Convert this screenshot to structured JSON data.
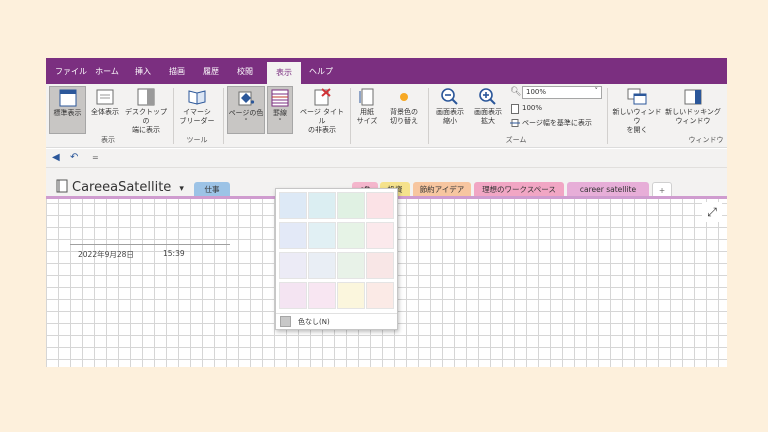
{
  "menu": {
    "tabs": [
      "ファイル",
      "ホーム",
      "挿入",
      "描画",
      "履歴",
      "校閲",
      "表示",
      "ヘルプ"
    ],
    "active": "表示"
  },
  "ribbon": {
    "normal_view": "標準表示",
    "full_page": "全体表示",
    "dock_line1": "デスクトップの",
    "dock_line2": "端に表示",
    "group_view": "表示",
    "immersive_line1": "イマーシ",
    "immersive_line2": "ブリーダー",
    "group_tools": "ツール",
    "page_color": "ページの色",
    "rule_lines": "罫線",
    "hide_title_line1": "ページ タイトル",
    "hide_title_line2": "の非表示",
    "paper_line1": "用紙",
    "paper_line2": "サイズ",
    "bg_line1": "背景色の",
    "bg_line2": "切り替え",
    "zoom_out_line1": "画面表示",
    "zoom_out_line2": "縮小",
    "zoom_in_line1": "画面表示",
    "zoom_in_line2": "拡大",
    "zoom_value": "100%",
    "zoom_100": "100%",
    "page_width": "ページ幅を基準に表示",
    "group_zoom": "ズーム",
    "new_window_line1": "新しいウィンドウ",
    "new_window_line2": "を開く",
    "new_dock_line1": "新しいドッキング",
    "new_dock_line2": "ウィンドウ",
    "group_window": "ウィンドウ",
    "dropdown_arrow": "˅"
  },
  "qat": {
    "back": "◀",
    "undo": "↶",
    "more": "="
  },
  "notebook": {
    "name": "CareeaSatellite",
    "arrow": "▾",
    "sections": [
      {
        "label": "仕事",
        "color": "#9cc3e6"
      },
      {
        "label": "oft",
        "color": "#f4b6cc"
      },
      {
        "label": "投資",
        "color": "#f5e28c"
      },
      {
        "label": "節約アイデア",
        "color": "#f7c6a0"
      },
      {
        "label": "理想のワークスペース",
        "color": "#f1a6c4"
      },
      {
        "label": "career satellite",
        "color": "#e7aed8"
      }
    ],
    "add_tab": "+"
  },
  "page": {
    "date": "2022年9月28日",
    "time": "15:39",
    "expand": "⤢"
  },
  "dropdown": {
    "swatches": [
      "#dde9f6",
      "#dbeef2",
      "#e0f1e3",
      "#fbe2e6",
      "#e3e9f7",
      "#e1f0f4",
      "#e6f3e6",
      "#fbe9ec",
      "#ecebf6",
      "#e9eef5",
      "#e8f2e8",
      "#f8e6e6",
      "#f4e4f2",
      "#f8e6f2",
      "#fbf6dd",
      "#fbeae6"
    ],
    "no_color": "色なし(N)"
  },
  "colors": {
    "accent": "#7b2f80",
    "background": "#fdf0dc"
  }
}
